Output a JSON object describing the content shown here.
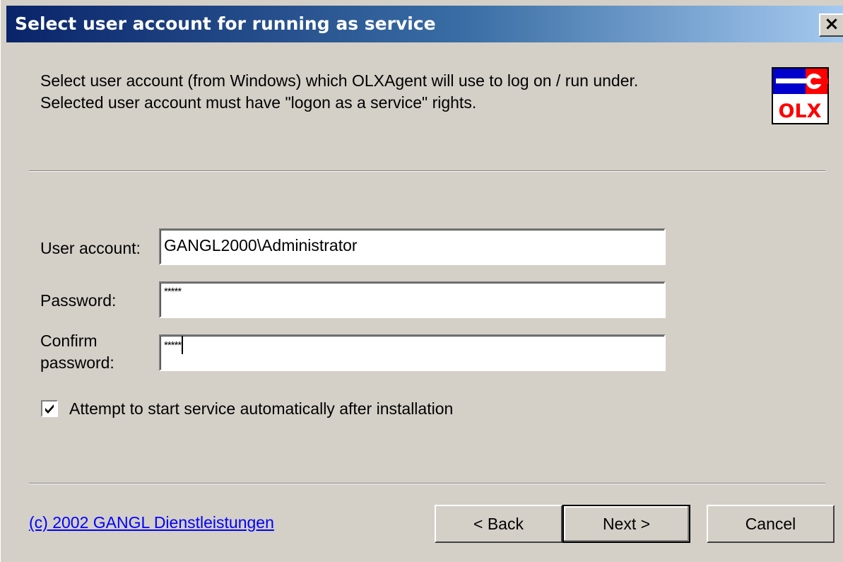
{
  "window": {
    "title": "Select user account for running as service",
    "close_label": "×"
  },
  "header": {
    "line1": "Select user account (from Windows) which OLXAgent will use to log on / run under.",
    "line2": "Selected user account must have \"logon as a service\" rights.",
    "logo": {
      "icon": "olx-logo-icon",
      "text": "OLX",
      "colors": {
        "blue": "#0000cc",
        "red": "#ff0000"
      }
    }
  },
  "form": {
    "user_account": {
      "label": "User account:",
      "value": "GANGL2000\\Administrator"
    },
    "password": {
      "label": "Password:",
      "value": "*****"
    },
    "confirm_password": {
      "label_line1": "Confirm",
      "label_line2": "password:",
      "value": "*****"
    },
    "auto_start": {
      "label": "Attempt to start service automatically after installation",
      "checked": true
    }
  },
  "footer": {
    "copyright_link": "(c) 2002 GANGL Dienstleistungen",
    "back_label": "< Back",
    "next_label": "Next >",
    "cancel_label": "Cancel"
  },
  "colors": {
    "face": "#d4d0c8",
    "title_start": "#0a246a",
    "title_end": "#a6caf0",
    "link": "#0000ff"
  }
}
